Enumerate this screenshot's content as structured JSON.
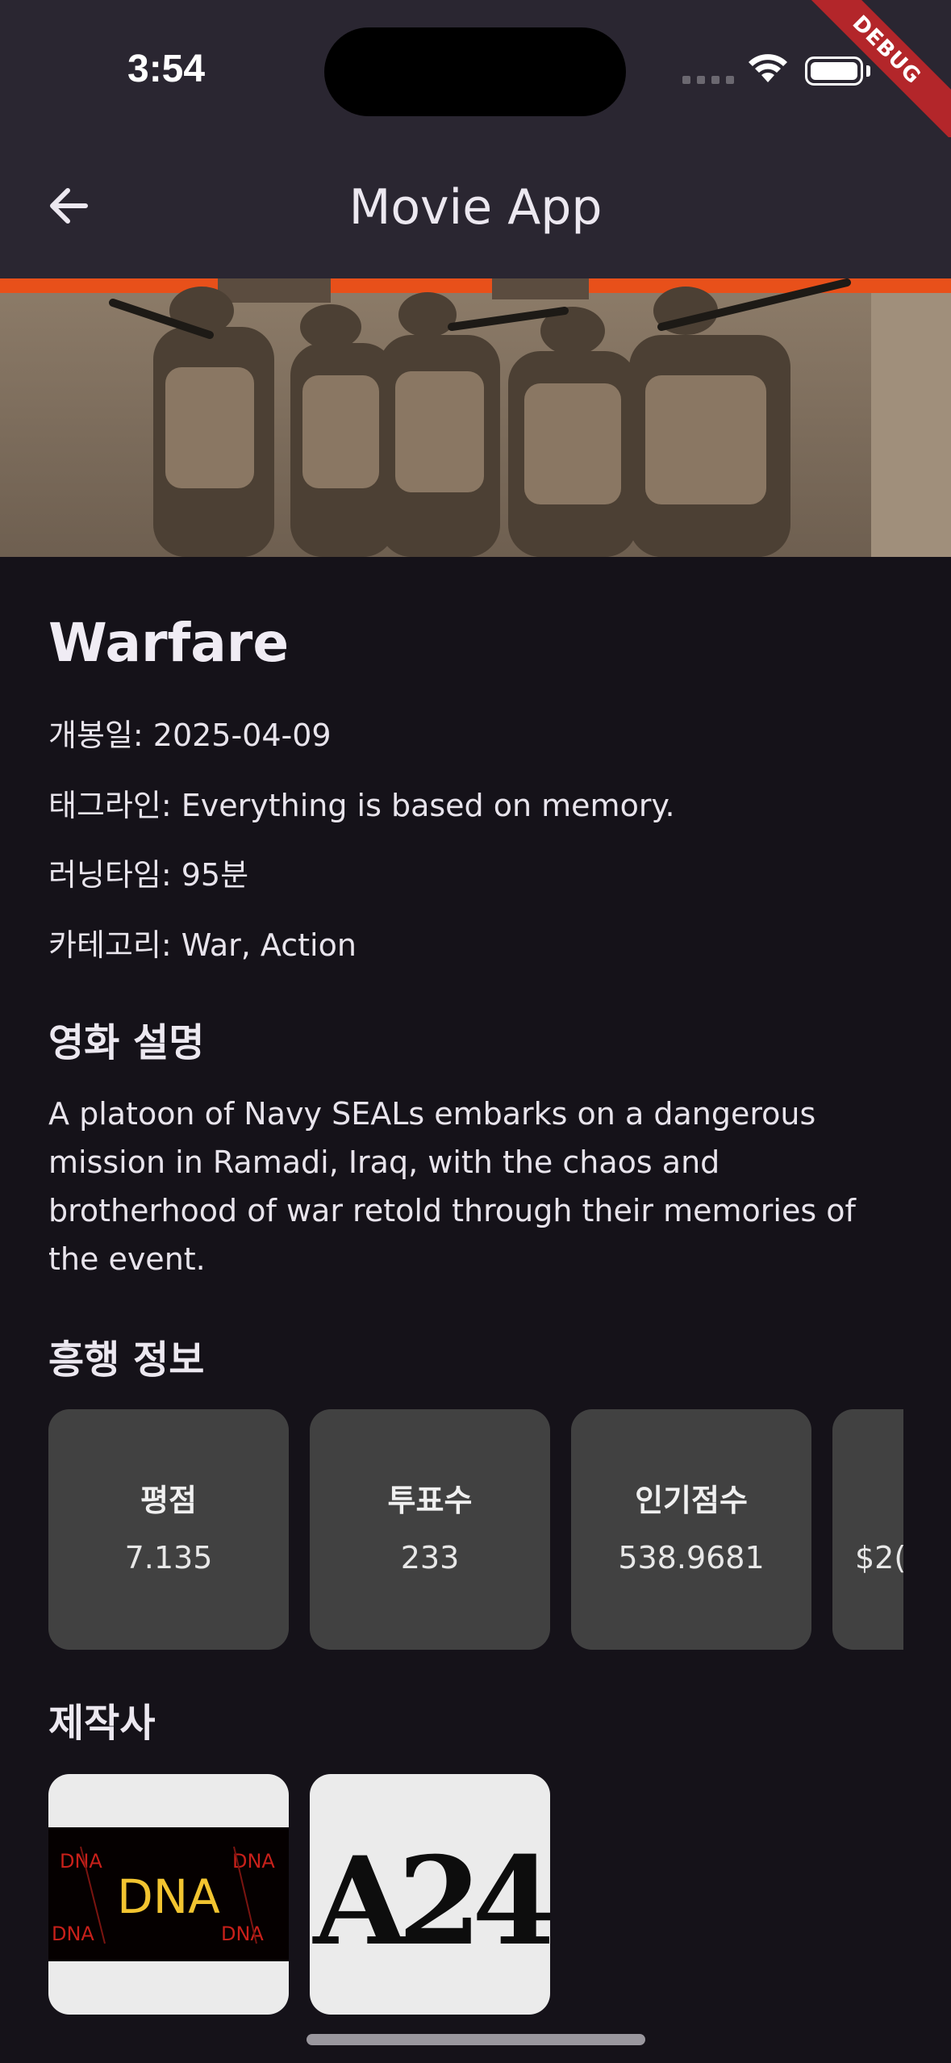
{
  "status_bar": {
    "time": "3:54",
    "debug_banner": "DEBUG"
  },
  "app_bar": {
    "title": "Movie App",
    "back_icon": "arrow-left-icon"
  },
  "movie": {
    "title": "Warfare",
    "release_date": "개봉일: 2025-04-09",
    "tagline": "태그라인: Everything is based on memory.",
    "runtime": "러닝타임: 95분",
    "category": "카테고리: War, Action"
  },
  "sections": {
    "overview_title": "영화 설명",
    "overview_text": "A platoon of Navy SEALs embarks on a dangerous mission in Ramadi, Iraq, with the chaos and brotherhood of war retold through their memories of the event.",
    "box_office_title": "흥행 정보",
    "producers_title": "제작사"
  },
  "stats": [
    {
      "label": "평점",
      "value": "7.135"
    },
    {
      "label": "투표수",
      "value": "233"
    },
    {
      "label": "인기점수",
      "value": "538.9681"
    },
    {
      "label": "",
      "value": "$2("
    }
  ],
  "producers": [
    {
      "logo_text": "DNA",
      "logo_icon": "dna-logo-icon"
    },
    {
      "logo_text": "A24",
      "logo_icon": "a24-logo-icon"
    }
  ],
  "colors": {
    "background": "#151219",
    "app_bar": "#2a2631",
    "card": "#414141",
    "accent_orange": "#e8501a"
  }
}
